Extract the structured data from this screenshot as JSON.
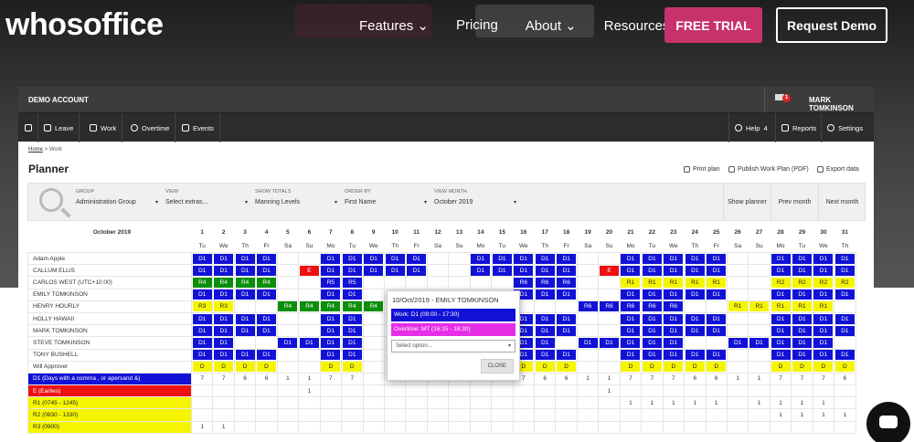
{
  "site": {
    "logo": "whosoffice",
    "nav": [
      "Features ⌄",
      "Pricing",
      "About ⌄",
      "Resources ⌄"
    ],
    "free_trial": "FREE TRIAL",
    "request_demo": "Request Demo"
  },
  "app": {
    "account": "DEMO ACCOUNT",
    "mail_count": "1",
    "user": "MARK TOMKINSON",
    "toolbar_left": [
      "Leave",
      "Work",
      "Overtime",
      "Events"
    ],
    "help": "Help",
    "help_count": "4",
    "reports": "Reports",
    "settings": "Settings",
    "breadcrumb": {
      "home": "Home",
      "sep": " > ",
      "current": "Work"
    },
    "title": "Planner",
    "actions": {
      "print": "Print plan",
      "publish": "Publish Work Plan (PDF)",
      "export": "Export data"
    },
    "filters": {
      "group_label": "GROUP",
      "group_value": "Administration Group",
      "view_label": "VIEW",
      "view_value": "Select extras...",
      "totals_label": "SHOW TOTALS",
      "totals_value": "Manning Levels",
      "order_label": "ORDER BY",
      "order_value": "First Name",
      "month_label": "VIEW MONTH",
      "month_value": "October 2019",
      "show_planner": "Show planner",
      "prev_month": "Prev month",
      "next_month": "Next month"
    },
    "grid": {
      "month": "October 2019",
      "days": [
        "1",
        "2",
        "3",
        "4",
        "5",
        "6",
        "7",
        "8",
        "9",
        "10",
        "11",
        "12",
        "13",
        "14",
        "15",
        "16",
        "17",
        "18",
        "19",
        "20",
        "21",
        "22",
        "23",
        "24",
        "25",
        "26",
        "27",
        "28",
        "29",
        "30",
        "31"
      ],
      "weekdays": [
        "Tu",
        "We",
        "Th",
        "Fr",
        "Sa",
        "Su",
        "Mo",
        "Tu",
        "We",
        "Th",
        "Fr",
        "Sa",
        "Su",
        "Mo",
        "Tu",
        "We",
        "Th",
        "Fr",
        "Sa",
        "Su",
        "Mo",
        "Tu",
        "We",
        "Th",
        "Fr",
        "Sa",
        "Su",
        "Mo",
        "Tu",
        "We",
        "Th"
      ],
      "rows": [
        {
          "name": "Adam Apple",
          "cells": [
            "D1",
            "D1",
            "D1",
            "D1",
            "",
            "",
            "D1",
            "D1",
            "D1",
            "D1",
            "D1",
            "",
            "",
            "D1",
            "D1",
            "D1",
            "D1",
            "D1",
            "",
            "",
            "D1",
            "D1",
            "D1",
            "D1",
            "D1",
            "",
            "",
            "D1",
            "D1",
            "D1",
            "D1"
          ]
        },
        {
          "name": "CALLUM ELLIS",
          "cells": [
            "D1",
            "D1",
            "D1",
            "D1",
            "",
            "E",
            "D1",
            "D1",
            "D1",
            "D1",
            "D1",
            "",
            "",
            "D1",
            "D1",
            "D1",
            "D1",
            "D1",
            "",
            "E",
            "D1",
            "D1",
            "D1",
            "D1",
            "D1",
            "",
            "",
            "D1",
            "D1",
            "D1",
            "D1"
          ]
        },
        {
          "name": "CARLOS WEST (UTC+10:00)",
          "cells": [
            "R4",
            "R4",
            "R4",
            "R4",
            "",
            "",
            "R5",
            "R5",
            "",
            "",
            "",
            "",
            "",
            "",
            "",
            "R6",
            "R6",
            "R6",
            "",
            "",
            "R1",
            "R1",
            "R1",
            "R1",
            "R1",
            "",
            "",
            "R2",
            "R2",
            "R2",
            "R2"
          ]
        },
        {
          "name": "EMILY TOMKINSON",
          "cells": [
            "D1",
            "D1",
            "D1",
            "D1",
            "",
            "",
            "D1",
            "D1",
            "",
            "",
            "",
            "",
            "",
            "",
            "",
            "D1",
            "D1",
            "D1",
            "",
            "",
            "D1",
            "D1",
            "D1",
            "D1",
            "D1",
            "",
            "",
            "D1",
            "D1",
            "D1",
            "D1"
          ]
        },
        {
          "name": "HENRY HOURLY",
          "cells": [
            "R3",
            "R3",
            "",
            "",
            "R4",
            "R4",
            "R4",
            "R4",
            "R4",
            "",
            "",
            "",
            "",
            "",
            "R5",
            "",
            "",
            "",
            "R6",
            "R6",
            "R6",
            "R6",
            "R6",
            "",
            "",
            "R1",
            "R1",
            "R1",
            "R1",
            "R1",
            ""
          ]
        },
        {
          "name": "HOLLY HAWAII",
          "cells": [
            "D1",
            "D1",
            "D1",
            "D1",
            "",
            "",
            "D1",
            "D1",
            "",
            "",
            "",
            "",
            "",
            "",
            "D1",
            "D1",
            "D1",
            "D1",
            "",
            "",
            "D1",
            "D1",
            "D1",
            "D1",
            "D1",
            "",
            "",
            "D1",
            "D1",
            "D1",
            "D1"
          ]
        },
        {
          "name": "MARK TOMKINSON",
          "cells": [
            "D1",
            "D1",
            "D1",
            "D1",
            "",
            "",
            "D1",
            "D1",
            "",
            "",
            "",
            "",
            "",
            "",
            "D1",
            "D1",
            "D1",
            "D1",
            "",
            "",
            "D1",
            "D1",
            "D1",
            "D1",
            "D1",
            "",
            "",
            "D1",
            "D1",
            "D1",
            "D1"
          ]
        },
        {
          "name": "STEVE TOMKINSON",
          "cells": [
            "D1",
            "D1",
            "",
            "",
            "D1",
            "D1",
            "D1",
            "D1",
            "",
            "",
            "",
            "",
            "",
            "",
            "D1",
            "D1",
            "D1",
            "",
            "D1",
            "D1",
            "D1",
            "D1",
            "D1",
            "",
            "",
            "D1",
            "D1",
            "D1",
            "D1",
            "D1",
            ""
          ]
        },
        {
          "name": "TONY BUSHELL",
          "cells": [
            "D1",
            "D1",
            "D1",
            "D1",
            "",
            "",
            "D1",
            "D1",
            "",
            "",
            "",
            "",
            "",
            "",
            "D1",
            "D1",
            "D1",
            "D1",
            "",
            "",
            "D1",
            "D1",
            "D1",
            "D1",
            "D1",
            "",
            "",
            "D1",
            "D1",
            "D1",
            "D1"
          ]
        },
        {
          "name": "Will Approver",
          "cells": [
            "D",
            "D",
            "D",
            "D",
            "",
            "",
            "D",
            "D",
            "",
            "",
            "",
            "",
            "",
            "",
            "D",
            "D",
            "D",
            "D",
            "",
            "",
            "D",
            "D",
            "D",
            "D",
            "D",
            "",
            "",
            "D",
            "D",
            "D",
            "D"
          ]
        }
      ],
      "legend": [
        {
          "name": "D1 (Days with a comma , or apersand &)",
          "color": "blue",
          "cells": [
            "7",
            "7",
            "6",
            "6",
            "1",
            "1",
            "7",
            "7",
            "",
            "6",
            "6",
            "1",
            "1",
            "7",
            "7",
            "7",
            "6",
            "6",
            "1",
            "1",
            "7",
            "7",
            "7",
            "6",
            "6",
            "1",
            "1",
            "7",
            "7",
            "7",
            "6"
          ]
        },
        {
          "name": "E (Earlies)",
          "color": "red",
          "cells": [
            "",
            "",
            "",
            "",
            "",
            "1",
            "",
            "",
            "",
            "",
            "",
            "",
            "",
            "",
            "",
            "",
            "",
            "",
            "",
            "1",
            "",
            "",
            "",
            "",
            "",
            "",
            "",
            "",
            "",
            "",
            ""
          ]
        },
        {
          "name": "R1 (0745 - 1245)",
          "color": "yellow",
          "cells": [
            "",
            "",
            "",
            "",
            "",
            "",
            "",
            "",
            "",
            "",
            "",
            "",
            "",
            "",
            "",
            "",
            "",
            "",
            "",
            "",
            "1",
            "1",
            "1",
            "1",
            "1",
            "",
            "1",
            "1",
            "1",
            "1",
            ""
          ]
        },
        {
          "name": "R2 (0830 - 1330)",
          "color": "yellow",
          "cells": [
            "",
            "",
            "",
            "",
            "",
            "",
            "",
            "",
            "",
            "",
            "",
            "",
            "",
            "",
            "",
            "",
            "",
            "",
            "",
            "",
            "",
            "",
            "",
            "",
            "",
            "",
            "",
            "1",
            "1",
            "1",
            "1"
          ]
        },
        {
          "name": "R3 (0900)",
          "color": "yellow",
          "cells": [
            "1",
            "1",
            "",
            "",
            "",
            "",
            "",
            "",
            "",
            "",
            "",
            "",
            "",
            "",
            "",
            "",
            "",
            "",
            "",
            "",
            "",
            "",
            "",
            "",
            "",
            "",
            "",
            "",
            "",
            "",
            ""
          ]
        }
      ]
    },
    "popup": {
      "title": "10/Oct/2019 - EMILY TOMKINSON",
      "work": "Work: D1 (09:00 - 17:30)",
      "overtime": "Overtime: MT (16:15 - 16:30)",
      "select": "Select option...",
      "close": "CLOSE"
    }
  },
  "colors": {
    "brand": "#c8326b",
    "shift_blue": "#1212d6",
    "shift_green": "#0b8f0b",
    "shift_yellow": "#f5f500",
    "shift_red": "#e11111",
    "overtime": "#e62ee6"
  }
}
